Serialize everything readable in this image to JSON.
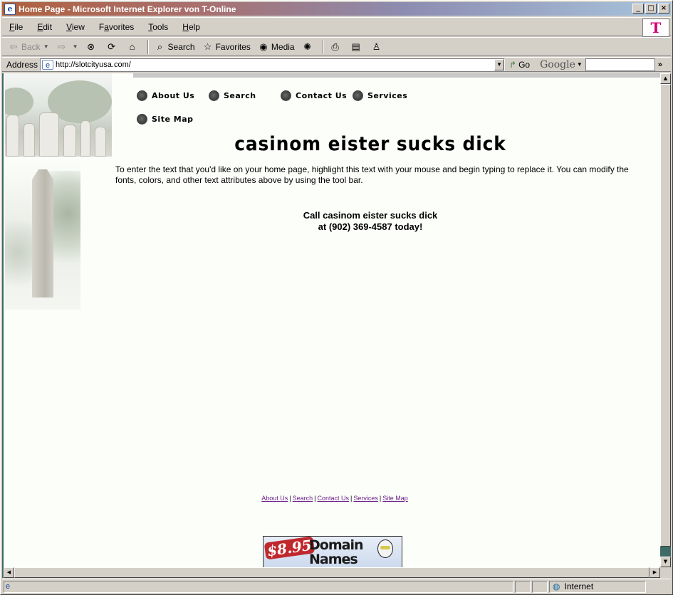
{
  "window": {
    "title": "Home Page - Microsoft Internet Explorer von T-Online",
    "controls": {
      "minimize": "_",
      "maximize": "□",
      "close": "×"
    }
  },
  "menu": {
    "items": [
      {
        "label": "File",
        "key": "F",
        "rest": "ile"
      },
      {
        "label": "Edit",
        "key": "E",
        "rest": "dit"
      },
      {
        "label": "View",
        "key": "V",
        "rest": "iew"
      },
      {
        "label": "Favorites",
        "key": "F",
        "rest": "avorites",
        "prefix": ""
      },
      {
        "label": "Tools",
        "key": "T",
        "rest": "ools"
      },
      {
        "label": "Help",
        "key": "H",
        "rest": "elp"
      }
    ],
    "brand_logo": "T"
  },
  "toolbar": {
    "back": "Back",
    "search": "Search",
    "favorites": "Favorites",
    "media": "Media"
  },
  "address": {
    "label": "Address",
    "url": "http://slotcityusa.com/",
    "go": "Go",
    "google": "Google"
  },
  "page": {
    "nav": {
      "about": "About Us",
      "search": "Search",
      "contact": "Contact Us",
      "services": "Services",
      "sitemap": "Site Map"
    },
    "headline": "casinom eister sucks dick",
    "intro": "To enter the text that you'd like on your home page, highlight this text with your mouse and begin typing to replace it.  You can modify the fonts, colors, and other text attributes above by using the tool bar.",
    "call_line1": "Call casinom eister sucks dick",
    "call_line2": "at (902) 369-4587 today!",
    "footer_links": [
      "About Us",
      "Search",
      "Contact Us",
      "Services",
      "Site Map"
    ],
    "ad": {
      "price": "$8.95",
      "text_line1": "Domain",
      "text_line2": "Names",
      "brand": "Go Daddy"
    }
  },
  "status": {
    "zone": "Internet"
  }
}
